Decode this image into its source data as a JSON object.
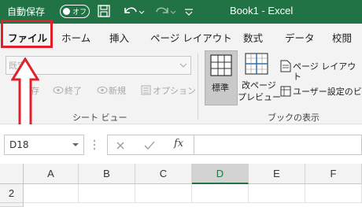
{
  "titlebar": {
    "autosave_label": "自動保存",
    "autosave_state": "オフ",
    "title": "Book1  -  Excel"
  },
  "tabs": [
    {
      "label": "ファイル",
      "active": true
    },
    {
      "label": "ホーム"
    },
    {
      "label": "挿入"
    },
    {
      "label": "ページ レイアウト"
    },
    {
      "label": "数式"
    },
    {
      "label": "データ"
    },
    {
      "label": "校閲"
    }
  ],
  "sheet_view": {
    "dropdown_value": "既定",
    "commands": [
      "保存",
      "終了",
      "新規",
      "オプション"
    ],
    "group_label": "シート ビュー"
  },
  "workbook_views": {
    "normal_label": "標準",
    "page_break_label_1": "改ページ",
    "page_break_label_2": "プレビュー",
    "page_layout_label": "ページ レイアウト",
    "custom_views_label": "ユーザー設定のビュー",
    "group_label": "ブックの表示"
  },
  "formula_bar": {
    "name_box": "D18",
    "fx_label": "fx",
    "formula": ""
  },
  "grid": {
    "columns": [
      "A",
      "B",
      "C",
      "D",
      "E",
      "F"
    ],
    "selected_column": "D",
    "rows": [
      "2"
    ]
  },
  "colors": {
    "excel_green": "#217346",
    "highlight_red": "#e0202a"
  }
}
